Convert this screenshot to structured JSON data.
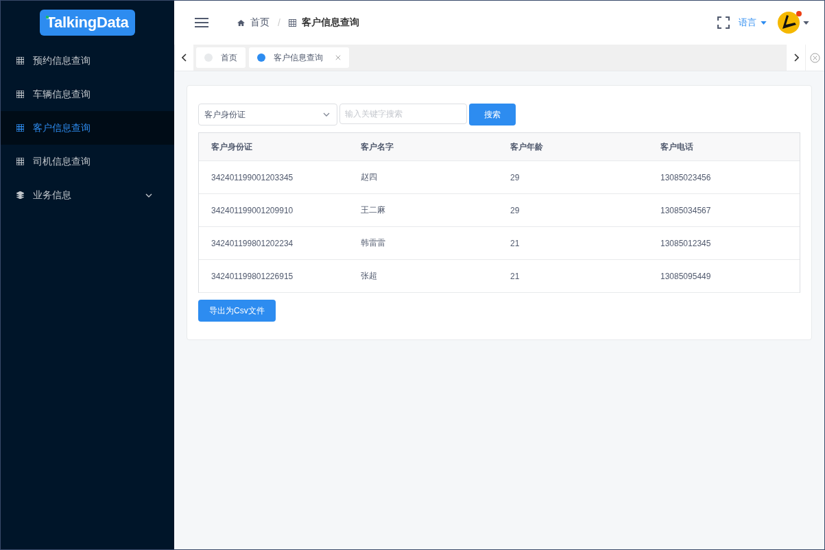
{
  "logo": "TalkingData",
  "sidebar": {
    "items": [
      {
        "label": "预约信息查询",
        "kind": "link",
        "selected": false
      },
      {
        "label": "车辆信息查询",
        "kind": "link",
        "selected": false
      },
      {
        "label": "客户信息查询",
        "kind": "link",
        "selected": true
      },
      {
        "label": "司机信息查询",
        "kind": "link",
        "selected": false
      },
      {
        "label": "业务信息",
        "kind": "submenu",
        "selected": false,
        "expanded": false
      }
    ]
  },
  "breadcrumb": {
    "separator": "/",
    "items": [
      "首页",
      "客户信息查询"
    ]
  },
  "header": {
    "language": "语言",
    "notification_dot": true
  },
  "tabs": [
    {
      "label": "首页",
      "selected": false,
      "closable": false
    },
    {
      "label": "客户信息查询",
      "selected": true,
      "closable": true
    }
  ],
  "search": {
    "field": "客户身份证",
    "placeholder": "输入关键字搜索",
    "button": "搜索"
  },
  "table": {
    "columns": [
      "客户身份证",
      "客户名字",
      "客户年龄",
      "客户电话"
    ],
    "rows": [
      [
        "342401199001203345",
        "赵四",
        "29",
        "13085023456"
      ],
      [
        "342401199001209910",
        "王二麻",
        "29",
        "13085034567"
      ],
      [
        "342401199801202234",
        "韩雷雷",
        "21",
        "13085012345"
      ],
      [
        "342401199801226915",
        "张超",
        "21",
        "13085095449"
      ]
    ]
  },
  "export_button": "导出为Csv文件"
}
